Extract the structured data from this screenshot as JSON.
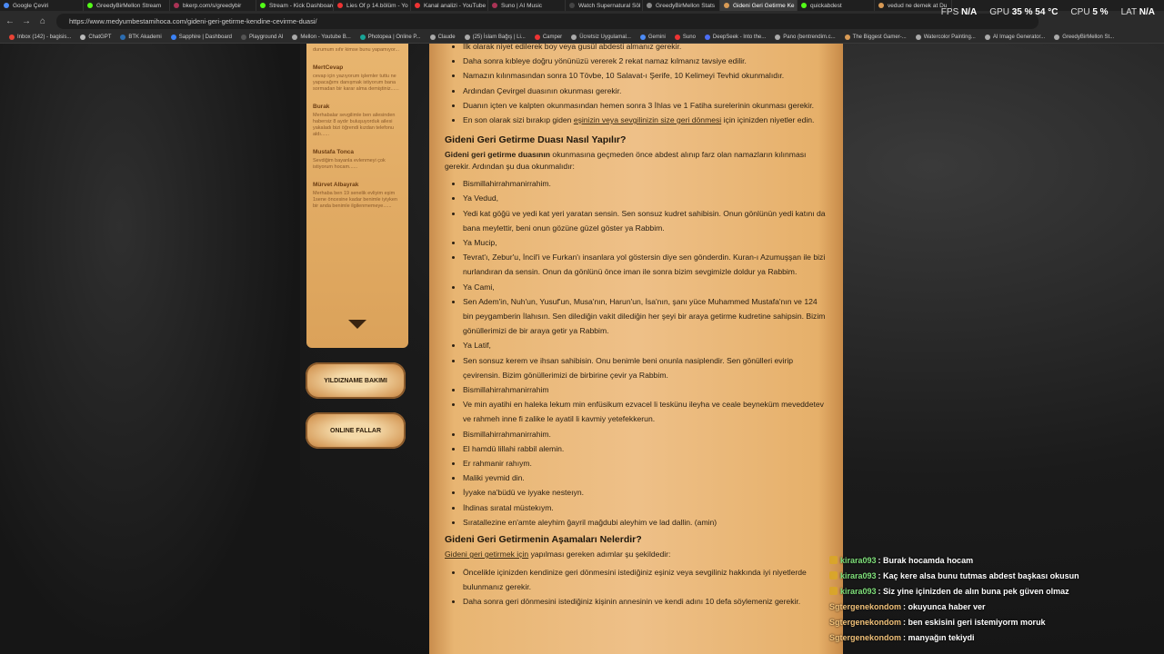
{
  "browser": {
    "tabs": [
      {
        "label": "Google Çeviri",
        "color": "#4c8bf5"
      },
      {
        "label": "GreedyBirMellon Stream",
        "color": "#53fc18"
      },
      {
        "label": "bkerp.com/s/greedybir",
        "color": "#aa3355"
      },
      {
        "label": "Stream - Kick Dashboard",
        "color": "#53fc18"
      },
      {
        "label": "Lies Of p 14.bölüm - Yo",
        "color": "#e33"
      },
      {
        "label": "Kanal analizi - YouTube",
        "color": "#e33"
      },
      {
        "label": "Suno | AI Music",
        "color": "#aa3355"
      },
      {
        "label": "Watch Supernatural Söl",
        "color": "#444"
      },
      {
        "label": "GreedyBirMellon Stats",
        "color": "#888"
      },
      {
        "label": "Gideni Geri Getirme Ke",
        "color": "#d89a55"
      },
      {
        "label": "quickabdest",
        "color": "#53fc18"
      },
      {
        "label": "vedud ne demek at Du",
        "color": "#d89a55"
      }
    ],
    "url": "https://www.medyumbestamihoca.com/gideni-geri-getirme-kendine-cevirme-duasi/",
    "bookmarks": [
      {
        "label": "Inbox (142) - bagisis...",
        "color": "#ea4335"
      },
      {
        "label": "ChatGPT",
        "color": "#bbb"
      },
      {
        "label": "BTK Akademi",
        "color": "#2b6cb0"
      },
      {
        "label": "Sapphire | Dashboard",
        "color": "#3b82f6"
      },
      {
        "label": "Playground AI",
        "color": "#555"
      },
      {
        "label": "Mellon - Youtube B...",
        "color": "#aaa"
      },
      {
        "label": "Photopea | Online P...",
        "color": "#18a497"
      },
      {
        "label": "Claude",
        "color": "#aaa"
      },
      {
        "label": "(25) İslam Bağış | Li...",
        "color": "#aaa"
      },
      {
        "label": "Camper",
        "color": "#e33"
      },
      {
        "label": "Ücretsiz Uygulamal...",
        "color": "#aaa"
      },
      {
        "label": "Gemini",
        "color": "#4c8bf5"
      },
      {
        "label": "Suno",
        "color": "#e33"
      },
      {
        "label": "DeepSeek - Into the...",
        "color": "#4c6ef5"
      },
      {
        "label": "Pano (bentrendim.c...",
        "color": "#aaa"
      },
      {
        "label": "The Biggest Gamer-...",
        "color": "#d89a55"
      },
      {
        "label": "Watercolor Painting...",
        "color": "#aaa"
      },
      {
        "label": "AI Image Generator...",
        "color": "#aaa"
      },
      {
        "label": "GreedyBirMellon St...",
        "color": "#aaa"
      }
    ]
  },
  "hud": {
    "fps_label": "FPS",
    "fps_value": "N/A",
    "gpu_label": "GPU",
    "gpu_value": "35 % 54 °C",
    "cpu_label": "CPU",
    "cpu_value": "5 %",
    "lat_label": "LAT",
    "lat_value": "N/A"
  },
  "sidebar": {
    "entries": [
      {
        "name": "",
        "text": "durumum sıfır kimse bunu yapamıyor..."
      },
      {
        "name": "MertCevap",
        "text": "cevap için yazıyorum işlemler tuttu ne yapacağımı danışmak istiyorum bana sormadan bir karar alma demiştiniz......"
      },
      {
        "name": "Burak",
        "text": "Merhabalar sevgilimle ben ailesinden habersiz 8 aydır buluşuyorduk ailesi yakaladı bizi öğrendi kızdan telefonu aldı......"
      },
      {
        "name": "Mustafa Tonca",
        "text": "Sevdiğim bayanla evlenmeyi çok istiyorum hocam......"
      },
      {
        "name": "Mürvet Albayrak",
        "text": "Merhaba ben 19 senelik evliyim eşim 1sene öncesine kadar benimle iyiyken bir anda benimle ilgilenmemeye......"
      }
    ],
    "btn_yildizname": "YILDIZNAME BAKIMI",
    "btn_fal": "ONLINE FALLAR"
  },
  "article": {
    "list1": [
      "İlk olarak niyet edilerek boy veya gusül abdesti almanız gerekir.",
      "Daha sonra kıbleye doğru yönünüzü vererek 2 rekat namaz kılmanız tavsiye edilir.",
      "Namazın kılınmasından sonra 10 Tövbe, 10 Salavat-ı Şerife, 10 Kelimeyi Tevhid okunmalıdır.",
      "Ardından Çevirgel duasının okunması gerekir.",
      "Duanın içten ve kalpten okunmasından hemen sonra 3 İhlas ve 1 Fatiha surelerinin okunması gerekir."
    ],
    "list1_last_pre": "En son olarak sizi bırakıp giden ",
    "list1_last_link": "eşinizin veya sevgilinizin size geri dönmesi",
    "list1_last_post": " için içinizden niyetler edin.",
    "h1": "Gideni Geri Getirme Duası Nasıl Yapılır?",
    "p1_bold": "Gideni geri getirme duasının",
    "p1_rest": " okunmasına geçmeden önce abdest alınıp farz olan namazların kılınması gerekir. Ardından şu dua okunmalıdır:",
    "list2": [
      "Bismillahirrahmanirrahim.",
      "Ya Vedud,",
      "Yedi kat göğü ve yedi kat yeri yaratan sensin. Sen sonsuz kudret sahibisin. Onun gönlünün yedi katını da bana meylettir, beni onun gözüne güzel göster ya Rabbim.",
      "Ya Mucip,",
      "Tevrat'ı, Zebur'u, İncil'i ve Furkan'ı insanlara yol göstersin diye sen gönderdin. Kuran-ı Azumuşşan ile bizi nurlandıran da sensin. Onun da gönlünü önce iman ile sonra bizim sevgimizle doldur ya Rabbim.",
      "Ya Cami,",
      "Sen Adem'in, Nuh'un, Yusuf'un, Musa'nın, Harun'un, İsa'nın, şanı yüce Muhammed Mustafa'nın ve 124 bin peygamberin İlahısın. Sen dilediğin vakit dilediğin her şeyi bir araya getirme kudretine sahipsin. Bizim gönüllerimizi de bir araya getir ya Rabbim.",
      "Ya Latif,",
      "Sen sonsuz kerem ve ihsan sahibisin. Onu benimle beni onunla nasiplendir. Sen gönülleri evirip çevirensin. Bizim gönüllerimizi de birbirine çevir ya Rabbim.",
      "Bismillahirrahmanirrahim",
      "Ve min ayatihi en haleka lekum min enfüsikum ezvacel li teskünu ileyha ve ceale beyneküm meveddetev ve rahmeh inne fi zalike le ayatil li kavmiy yetefekkerun.",
      "Bismillahirrahmanirrahim.",
      "El hamdü lillahi rabbil alemin.",
      "Er rahmanir rahıym.",
      "Maliki yevmid din.",
      "İyyake na'büdü ve iyyake nesteıyn.",
      "İhdinas sıratal müstekıym.",
      "Sıratallezine en'amte aleyhim ğayril mağdubi aleyhim ve lad dallin. (amin)"
    ],
    "h2": "Gideni Geri Getirmenin Aşamaları Nelerdir?",
    "p2_link": "Gideni geri getirmek için",
    "p2_rest": " yapılması gereken adımlar şu şekildedir:",
    "list3": [
      "Öncelikle içinizden kendinize geri dönmesini istediğiniz eşiniz veya sevgiliniz hakkında iyi niyetlerde bulunmanız gerekir.",
      "Daha sonra geri dönmesini istediğiniz kişinin annesinin ve kendi adını 10 defa söylemeniz gerekir."
    ]
  },
  "chat": [
    {
      "user": "kirara093",
      "text": ": Burak hocamda hocam",
      "badge": true,
      "style": "g"
    },
    {
      "user": "kirara093",
      "text": ": Kaç kere alsa bunu tutmas abdest başkası okusun",
      "badge": true,
      "style": "g"
    },
    {
      "user": "kirara093",
      "text": ": Siz yine içinizden de alın buna pek güven olmaz",
      "badge": true,
      "style": "g"
    },
    {
      "user": "Sgtergenekondom",
      "text": ": okuyunca haber ver",
      "badge": false,
      "style": "o"
    },
    {
      "user": "Sgtergenekondom",
      "text": ": ben eskisini geri istemiyorm moruk",
      "badge": false,
      "style": "o"
    },
    {
      "user": "Sgtergenekondom",
      "text": ": manyağın tekiydi",
      "badge": false,
      "style": "o"
    }
  ]
}
